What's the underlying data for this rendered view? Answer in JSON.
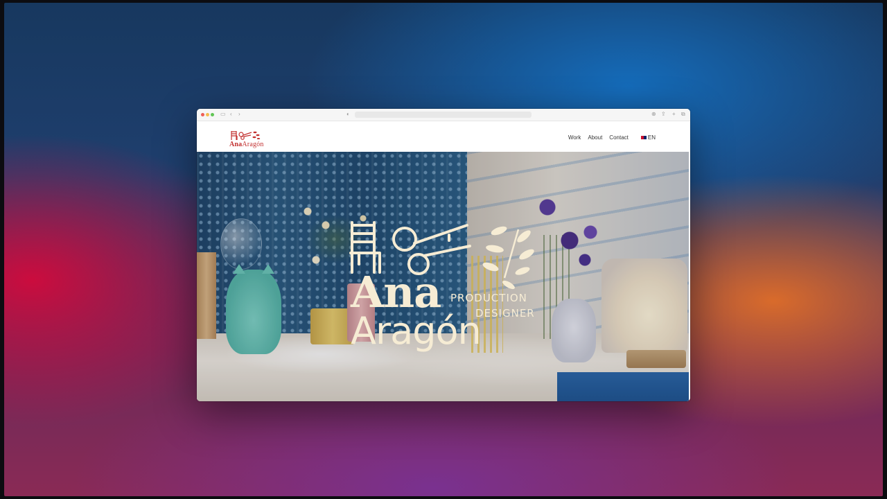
{
  "site": {
    "logo_name": "Ana",
    "logo_surname": "Aragón",
    "nav": {
      "items": [
        {
          "label": "Work"
        },
        {
          "label": "About"
        },
        {
          "label": "Contact"
        }
      ],
      "language": "EN"
    },
    "hero": {
      "name": "Ana",
      "surname": "Aragón",
      "role_line_1": "PRODUCTION",
      "role_line_2": "DESIGNER"
    }
  },
  "colors": {
    "brand_red": "#c2302f",
    "hero_text": "#f6ecd4"
  },
  "icons": {
    "logo_chair": "chair-icon",
    "logo_scissors": "scissors-icon",
    "logo_leaves": "leaves-icon"
  }
}
